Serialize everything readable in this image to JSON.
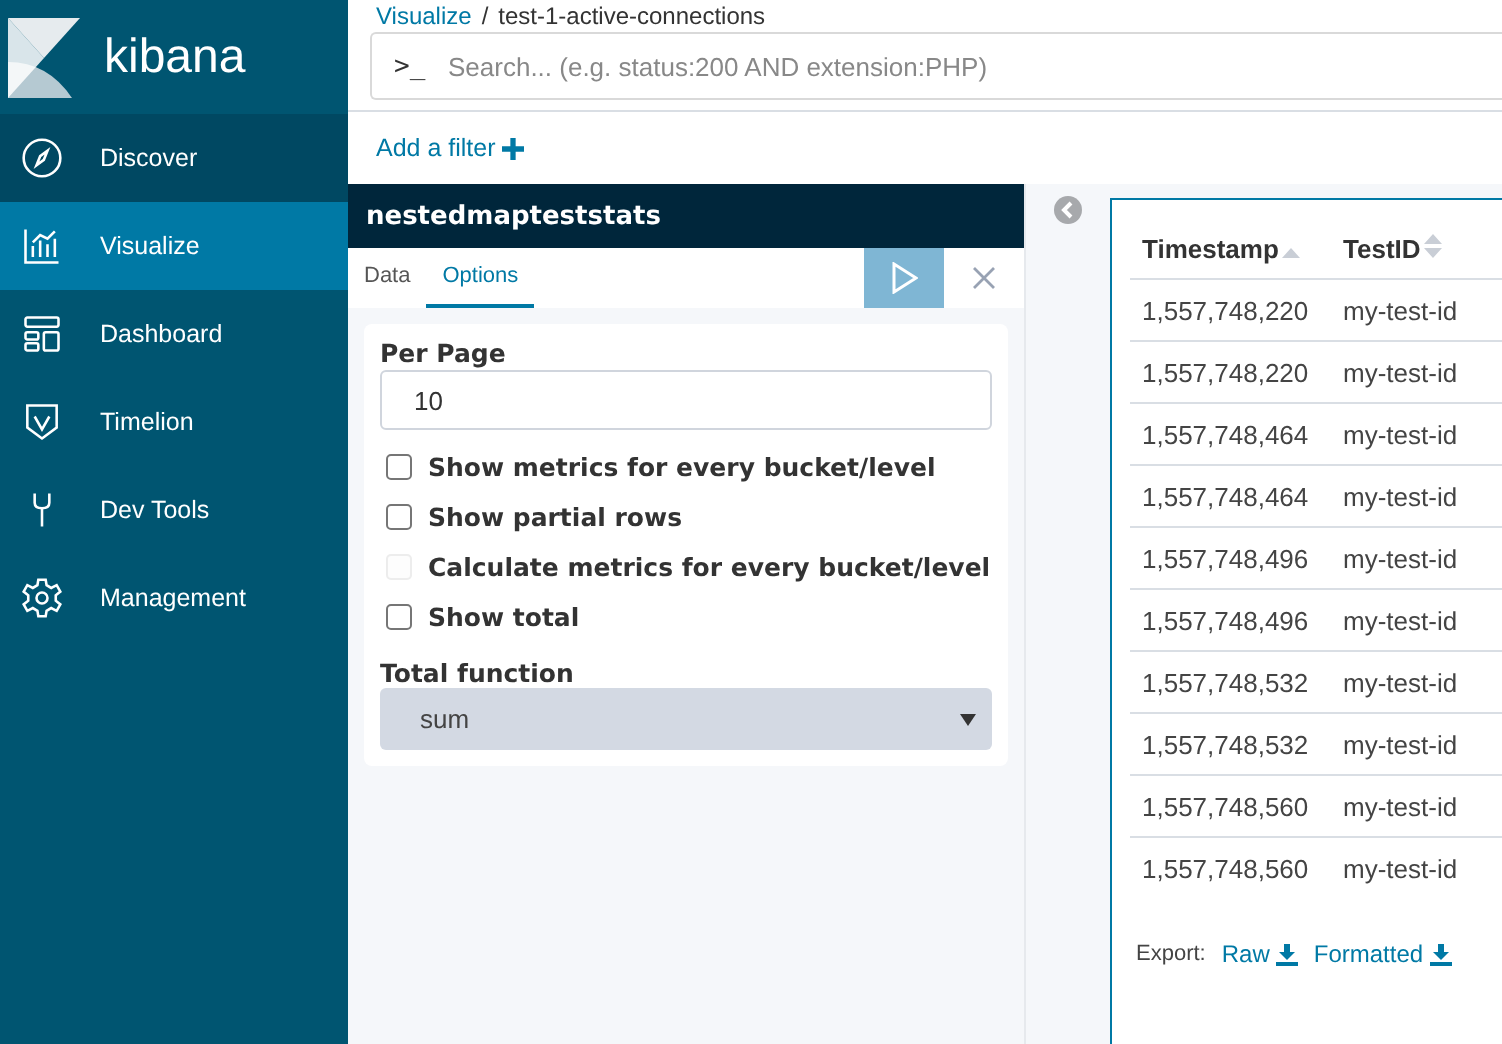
{
  "breadcrumb": {
    "parent": "Visualize",
    "separator": "/",
    "current": "test-1-active-connections"
  },
  "logo": {
    "text": "kibana"
  },
  "search": {
    "prompt": ">_",
    "placeholder": "Search... (e.g. status:200 AND extension:PHP)"
  },
  "add_filter": {
    "label": "Add a filter"
  },
  "sidebar": {
    "items": [
      {
        "label": "Discover",
        "selected": false
      },
      {
        "label": "Visualize",
        "selected": true
      },
      {
        "label": "Dashboard",
        "selected": false
      },
      {
        "label": "Timelion",
        "selected": false
      },
      {
        "label": "Dev Tools",
        "selected": false
      },
      {
        "label": "Management",
        "selected": false
      }
    ]
  },
  "editor": {
    "title": "nestedmapteststats",
    "tabs": [
      {
        "label": "Data",
        "selected": false
      },
      {
        "label": "Options",
        "selected": true
      }
    ],
    "per_page": {
      "label": "Per Page",
      "value": "10"
    },
    "checkboxes": [
      {
        "label": "Show metrics for every bucket/level",
        "checked": false,
        "disabled": false
      },
      {
        "label": "Show partial rows",
        "checked": false,
        "disabled": false
      },
      {
        "label": "Calculate metrics for every bucket/level",
        "checked": false,
        "disabled": true
      },
      {
        "label": "Show total",
        "checked": false,
        "disabled": false
      }
    ],
    "total_function": {
      "label": "Total function",
      "value": "sum"
    }
  },
  "table": {
    "columns": [
      {
        "label": "Timestamp"
      },
      {
        "label": "TestID"
      }
    ],
    "rows": [
      [
        "1,557,748,220",
        "my-test-id"
      ],
      [
        "1,557,748,220",
        "my-test-id"
      ],
      [
        "1,557,748,464",
        "my-test-id"
      ],
      [
        "1,557,748,464",
        "my-test-id"
      ],
      [
        "1,557,748,496",
        "my-test-id"
      ],
      [
        "1,557,748,496",
        "my-test-id"
      ],
      [
        "1,557,748,532",
        "my-test-id"
      ],
      [
        "1,557,748,532",
        "my-test-id"
      ],
      [
        "1,557,748,560",
        "my-test-id"
      ],
      [
        "1,557,748,560",
        "my-test-id"
      ]
    ],
    "export": {
      "label": "Export:",
      "links": [
        "Raw",
        "Formatted"
      ]
    }
  }
}
